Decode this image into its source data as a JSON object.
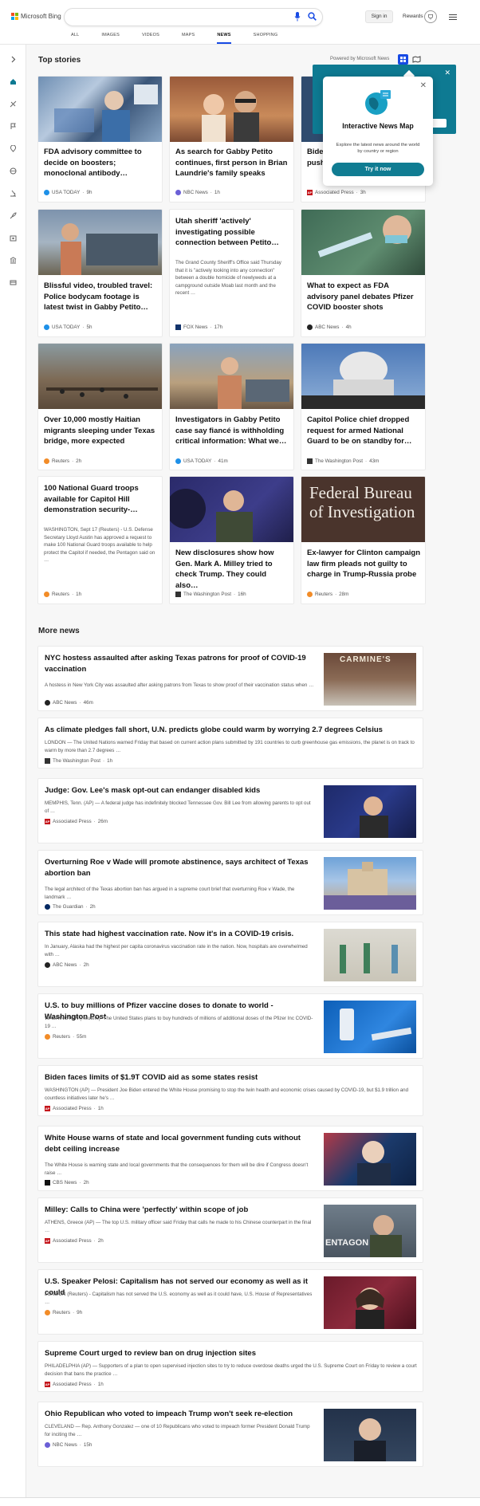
{
  "header": {
    "logo_text": "Microsoft Bing",
    "search_value": "",
    "signin_label": "Sign in",
    "rewards_label": "Rewards",
    "tabs": [
      "ALL",
      "IMAGES",
      "VIDEOS",
      "MAPS",
      "NEWS",
      "SHOPPING"
    ],
    "active_tab": "NEWS"
  },
  "top_stories": {
    "heading": "Top stories",
    "powered_by": "Powered by Microsoft News",
    "cards": [
      {
        "title": "FDA advisory committee to decide on boosters; monoclonal antibody…",
        "source": "USA TODAY",
        "time": "9h"
      },
      {
        "title": "As search for Gabby Petito continues, first person in Brian Laundrie's family speaks",
        "source": "NBC News",
        "time": "1h"
      },
      {
        "title": "Biden… push…",
        "source": "Associated Press",
        "time": "3h"
      },
      {
        "title": "Blissful video, troubled travel: Police bodycam footage is latest twist in Gabby Petito…",
        "source": "USA TODAY",
        "time": "5h"
      },
      {
        "title": "Utah sheriff 'actively' investigating possible connection between Petito…",
        "desc": "The Grand County Sheriff's Office said Thursday that it is \"actively looking into any connection\" between a double homicide of newlyweds at a campground outside Moab last month and the recent …",
        "source": "FOX News",
        "time": "17h"
      },
      {
        "title": "What to expect as FDA advisory panel debates Pfizer COVID booster shots",
        "source": "ABC News",
        "time": "4h"
      },
      {
        "title": "Over 10,000 mostly Haitian migrants sleeping under Texas bridge, more expected",
        "source": "Reuters",
        "time": "2h"
      },
      {
        "title": "Investigators in Gabby Petito case say fiancé is withholding critical information: What we…",
        "source": "USA TODAY",
        "time": "41m"
      },
      {
        "title": "Capitol Police chief dropped request for armed National Guard to be on standby for…",
        "source": "The Washington Post",
        "time": "43m"
      },
      {
        "title": "100 National Guard troops available for Capitol Hill demonstration security-…",
        "desc": "WASHINGTON, Sept 17 (Reuters) - U.S. Defense Secretary Lloyd Austin has approved a request to make 100 National Guard troops available to help protect the Capitol if needed, the Pentagon said on …",
        "source": "Reuters",
        "time": "1h"
      },
      {
        "title": "New disclosures show how Gen. Mark A. Milley tried to check Trump. They could also…",
        "source": "The Washington Post",
        "time": "16h"
      },
      {
        "title": "Ex-lawyer for Clinton campaign law firm pleads not guilty to charge in Trump-Russia probe",
        "source": "Reuters",
        "time": "28m"
      }
    ]
  },
  "thumb_text": {
    "carmines": "CARMINE'S",
    "fbi": "Federal Bureau of Investigation",
    "pentagon": "ENTAGON"
  },
  "popup": {
    "title": "Interactive News Map",
    "desc": "Explore the latest news around the world by country or region",
    "button": "Try it now"
  },
  "more_news": {
    "heading": "More news",
    "items": [
      {
        "title": "NYC hostess assaulted after asking Texas patrons for proof of COVID-19 vaccination",
        "desc": "A hostess in New York City was assaulted after asking patrons from Texas to show proof of their vaccination status when …",
        "source": "ABC News",
        "time": "46m"
      },
      {
        "title": "As climate pledges fall short, U.N. predicts globe could warm by worrying 2.7 degrees Celsius",
        "desc": "LONDON — The United Nations warned Friday that based on current action plans submitted by 191 countries to curb greenhouse gas emissions, the planet is on track to warm by more than 2.7 degrees …",
        "source": "The Washington Post",
        "time": "1h"
      },
      {
        "title": "Judge: Gov. Lee's mask opt-out can endanger disabled kids",
        "desc": "MEMPHIS, Tenn. (AP) — A federal judge has indefinitely blocked Tennessee Gov. Bill Lee from allowing parents to opt out of …",
        "source": "Associated Press",
        "time": "26m"
      },
      {
        "title": "Overturning Roe v Wade will promote abstinence, says architect of Texas abortion ban",
        "desc": "The legal architect of the Texas abortion ban has argued in a supreme court brief that overturning Roe v Wade, the landmark …",
        "source": "The Guardian",
        "time": "2h"
      },
      {
        "title": "This state had highest vaccination rate. Now it's in a COVID-19 crisis.",
        "desc": "In January, Alaska had the highest per capita coronavirus vaccination rate in the nation. Now, hospitals are overwhelmed with …",
        "source": "ABC News",
        "time": "2h"
      },
      {
        "title": "U.S. to buy millions of Pfizer vaccine doses to donate to world -Washington Post",
        "desc": "WASHINGTON (Reuters) -The United States plans to buy hundreds of millions of additional doses of the Pfizer Inc COVID-19 …",
        "source": "Reuters",
        "time": "55m"
      },
      {
        "title": "Biden faces limits of $1.9T COVID aid as some states resist",
        "desc": "WASHINGTON (AP) — President Joe Biden entered the White House promising to stop the twin health and economic crises caused by COVID-19, but $1.9 trillion and countless initiatives later he's …",
        "source": "Associated Press",
        "time": "1h"
      },
      {
        "title": "White House warns of state and local government funding cuts without debt ceiling increase",
        "desc": "The White House is warning state and local governments that the consequences for them will be dire if Congress doesn't raise …",
        "source": "CBS News",
        "time": "2h"
      },
      {
        "title": "Milley: Calls to China were 'perfectly' within scope of job",
        "desc": "ATHENS, Greece (AP) — The top U.S. military officer said Friday that calls he made to his Chinese counterpart in the final …",
        "source": "Associated Press",
        "time": "2h"
      },
      {
        "title": "U.S. Speaker Pelosi: Capitalism has not served our economy as well as it could",
        "desc": "LONDON (Reuters) - Capitalism has not served the U.S. economy as well as it could have, U.S. House of Representatives …",
        "source": "Reuters",
        "time": "9h"
      },
      {
        "title": "Supreme Court urged to review ban on drug injection sites",
        "desc": "PHILADELPHIA (AP) — Supporters of a plan to open supervised injection sites to try to reduce overdose deaths urged the U.S. Supreme Court on Friday to review a court decision that bans the practice …",
        "source": "Associated Press",
        "time": "1h"
      },
      {
        "title": "Ohio Republican who voted to impeach Trump won't seek re-election",
        "desc": "CLEVELAND — Rep. Anthony Gonzalez — one of 10 Republicans who voted to impeach former President Donald Trump for inciting the …",
        "source": "NBC News",
        "time": "15h"
      }
    ]
  },
  "colors": {
    "accent": "#174ae4",
    "popup_teal": "#107c92"
  }
}
